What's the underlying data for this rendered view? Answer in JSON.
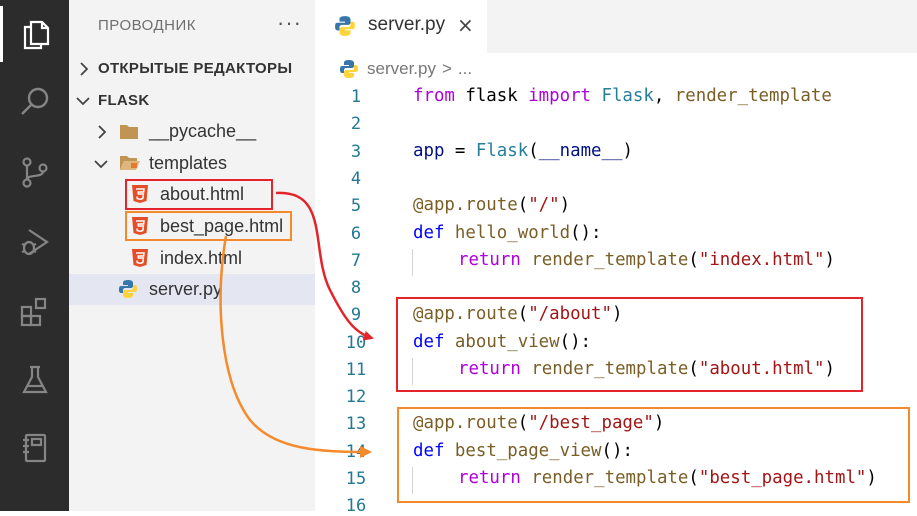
{
  "sidebar": {
    "title": "ПРОВОДНИК",
    "more": "···",
    "open_editors": "ОТКРЫТЫЕ РЕДАКТОРЫ",
    "folder": "FLASK",
    "items": [
      {
        "label": "__pycache__"
      },
      {
        "label": "templates"
      },
      {
        "label": "about.html"
      },
      {
        "label": "best_page.html"
      },
      {
        "label": "index.html"
      },
      {
        "label": "server.py"
      }
    ]
  },
  "editor": {
    "tab_label": "server.py",
    "close_glyph": "×",
    "breadcrumb": {
      "file": "server.py",
      "separator": ">",
      "rest": "..."
    }
  },
  "code_lines": [
    {
      "n": "1"
    },
    {
      "n": "2"
    },
    {
      "n": "3"
    },
    {
      "n": "4"
    },
    {
      "n": "5"
    },
    {
      "n": "6"
    },
    {
      "n": "7"
    },
    {
      "n": "8"
    },
    {
      "n": "9"
    },
    {
      "n": "10"
    },
    {
      "n": "11"
    },
    {
      "n": "12"
    },
    {
      "n": "13"
    },
    {
      "n": "14"
    },
    {
      "n": "15"
    },
    {
      "n": "16"
    }
  ],
  "code": {
    "l1": {
      "from": "from",
      "mod": " flask ",
      "import": "import",
      "cls": " Flask",
      "rest": ", ",
      "fn": "render_template"
    },
    "l3": {
      "var": "app",
      "eq": " = ",
      "cls": "Flask",
      "open": "(",
      "arg": "__name__",
      "close": ")"
    },
    "l5": {
      "dec": "@app.route",
      "open": "(",
      "str": "\"/\"",
      "close": ")"
    },
    "l6": {
      "kw": "def",
      "sp": " ",
      "fn": "hello_world",
      "rest": "():"
    },
    "l7": {
      "kw": "return",
      "sp": " ",
      "fn": "render_template",
      "open": "(",
      "str": "\"index.html\"",
      "close": ")"
    },
    "l9": {
      "dec": "@app.route",
      "open": "(",
      "str": "\"/about\"",
      "close": ")"
    },
    "l10": {
      "kw": "def",
      "sp": " ",
      "fn": "about_view",
      "rest": "():"
    },
    "l11": {
      "kw": "return",
      "sp": " ",
      "fn": "render_template",
      "open": "(",
      "str": "\"about.html\"",
      "close": ")"
    },
    "l13": {
      "dec": "@app.route",
      "open": "(",
      "str": "\"/best_page\"",
      "close": ")"
    },
    "l14": {
      "kw": "def",
      "sp": " ",
      "fn": "best_page_view",
      "rest": "():"
    },
    "l15": {
      "kw": "return",
      "sp": " ",
      "fn": "render_template",
      "open": "(",
      "str": "\"best_page.html\"",
      "close": ")"
    }
  },
  "colors": {
    "accent_red": "#e3242b",
    "accent_orange": "#f58a2c",
    "activity_bar": "#2c2c2c"
  },
  "icons": [
    "explorer-icon",
    "search-icon",
    "source-control-icon",
    "run-debug-icon",
    "extensions-icon",
    "testing-icon",
    "notebook-icon",
    "python-icon",
    "html5-icon",
    "folder-icon"
  ]
}
